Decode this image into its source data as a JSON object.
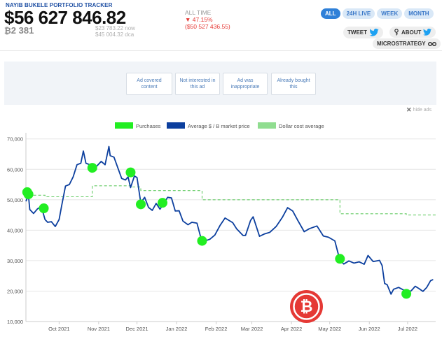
{
  "header": {
    "brand": "NAYIB BUKELE PORTFOLIO TRACKER",
    "portfolio_value": "$56 627 846.82",
    "btc_count": "2 381",
    "price_now": "$23 783.22 now",
    "price_dca": "$45 004.32 dca",
    "alltime_label": "ALL TIME",
    "alltime_pct": "▼ 47.15%",
    "alltime_delta": "($50 527 436.55)"
  },
  "tabs": [
    {
      "label": "ALL",
      "active": true
    },
    {
      "label": "24H LIVE",
      "active": false
    },
    {
      "label": "WEEK",
      "active": false
    },
    {
      "label": "MONTH",
      "active": false
    }
  ],
  "actions": {
    "tweet": "TWEET",
    "about": "ABOUT",
    "microstrategy": "MICROSTRATEGY"
  },
  "ad": {
    "options": [
      "Ad covered content",
      "Not interested in this ad",
      "Ad was inappropriate",
      "Already bought this"
    ],
    "hide_ads": "hide ads"
  },
  "colors": {
    "accent": "#2f80d8",
    "negative": "#e53935",
    "purchase": "#22ee22",
    "price_line": "#0c3f9e",
    "dca_line": "#66cc66"
  },
  "chart_data": {
    "type": "line",
    "legend": [
      "Purchases",
      "Average $ / B market price",
      "Dollar cost average"
    ],
    "x_ticks": [
      "Oct 2021",
      "Nov 2021",
      "Dec 2021",
      "Jan 2022",
      "Feb 2022",
      "Mar 2022",
      "Apr 2022",
      "May 2022",
      "Jun 2022",
      "Jul 2022"
    ],
    "y_ticks": [
      "10,000",
      "20,000",
      "30,000",
      "40,000",
      "50,000",
      "60,000",
      "70,000"
    ],
    "ylim": [
      10000,
      72000
    ],
    "xlim": [
      "2021-09-05",
      "2022-07-23"
    ],
    "series": [
      {
        "name": "Average $ / B market price",
        "points": [
          [
            "2021-09-05",
            49500
          ],
          [
            "2021-09-07",
            51500
          ],
          [
            "2021-09-08",
            46800
          ],
          [
            "2021-09-11",
            45500
          ],
          [
            "2021-09-14",
            47000
          ],
          [
            "2021-09-17",
            47800
          ],
          [
            "2021-09-20",
            43500
          ],
          [
            "2021-09-22",
            42600
          ],
          [
            "2021-09-25",
            42800
          ],
          [
            "2021-09-28",
            41200
          ],
          [
            "2021-10-01",
            43500
          ],
          [
            "2021-10-03",
            48000
          ],
          [
            "2021-10-06",
            54500
          ],
          [
            "2021-10-09",
            55000
          ],
          [
            "2021-10-12",
            57500
          ],
          [
            "2021-10-15",
            61500
          ],
          [
            "2021-10-18",
            62000
          ],
          [
            "2021-10-20",
            66000
          ],
          [
            "2021-10-22",
            62000
          ],
          [
            "2021-10-25",
            61500
          ],
          [
            "2021-10-28",
            60000
          ],
          [
            "2021-10-31",
            61300
          ],
          [
            "2021-11-03",
            62600
          ],
          [
            "2021-11-06",
            61500
          ],
          [
            "2021-11-09",
            67500
          ],
          [
            "2021-11-10",
            64500
          ],
          [
            "2021-11-13",
            64000
          ],
          [
            "2021-11-16",
            60500
          ],
          [
            "2021-11-19",
            57000
          ],
          [
            "2021-11-22",
            56500
          ],
          [
            "2021-11-24",
            57500
          ],
          [
            "2021-11-26",
            54000
          ],
          [
            "2021-11-29",
            57800
          ],
          [
            "2021-12-01",
            57300
          ],
          [
            "2021-12-04",
            49000
          ],
          [
            "2021-12-07",
            50800
          ],
          [
            "2021-12-10",
            47500
          ],
          [
            "2021-12-13",
            46500
          ],
          [
            "2021-12-16",
            48800
          ],
          [
            "2021-12-19",
            46900
          ],
          [
            "2021-12-22",
            48800
          ],
          [
            "2021-12-25",
            50800
          ],
          [
            "2021-12-28",
            50600
          ],
          [
            "2021-12-31",
            46300
          ],
          [
            "2022-01-03",
            46400
          ],
          [
            "2022-01-06",
            43000
          ],
          [
            "2022-01-10",
            41800
          ],
          [
            "2022-01-13",
            42600
          ],
          [
            "2022-01-17",
            42300
          ],
          [
            "2022-01-21",
            36000
          ],
          [
            "2022-01-24",
            36600
          ],
          [
            "2022-01-27",
            37000
          ],
          [
            "2022-01-31",
            38400
          ],
          [
            "2022-02-04",
            41500
          ],
          [
            "2022-02-08",
            44000
          ],
          [
            "2022-02-10",
            43500
          ],
          [
            "2022-02-14",
            42500
          ],
          [
            "2022-02-17",
            40500
          ],
          [
            "2022-02-22",
            38300
          ],
          [
            "2022-02-24",
            38300
          ],
          [
            "2022-02-28",
            43200
          ],
          [
            "2022-03-02",
            44400
          ],
          [
            "2022-03-07",
            38000
          ],
          [
            "2022-03-11",
            38800
          ],
          [
            "2022-03-15",
            39300
          ],
          [
            "2022-03-20",
            41200
          ],
          [
            "2022-03-25",
            44300
          ],
          [
            "2022-03-29",
            47400
          ],
          [
            "2022-04-02",
            46300
          ],
          [
            "2022-04-06",
            43200
          ],
          [
            "2022-04-11",
            39500
          ],
          [
            "2022-04-15",
            40500
          ],
          [
            "2022-04-21",
            41400
          ],
          [
            "2022-04-26",
            38100
          ],
          [
            "2022-04-30",
            37700
          ],
          [
            "2022-05-05",
            36500
          ],
          [
            "2022-05-09",
            30100
          ],
          [
            "2022-05-12",
            28900
          ],
          [
            "2022-05-16",
            29900
          ],
          [
            "2022-05-20",
            29200
          ],
          [
            "2022-05-24",
            29600
          ],
          [
            "2022-05-28",
            28800
          ],
          [
            "2022-05-31",
            31700
          ],
          [
            "2022-06-04",
            29700
          ],
          [
            "2022-06-09",
            30100
          ],
          [
            "2022-06-11",
            28400
          ],
          [
            "2022-06-13",
            22500
          ],
          [
            "2022-06-15",
            22100
          ],
          [
            "2022-06-18",
            19000
          ],
          [
            "2022-06-20",
            20600
          ],
          [
            "2022-06-24",
            21200
          ],
          [
            "2022-06-28",
            20300
          ],
          [
            "2022-07-01",
            19300
          ],
          [
            "2022-07-04",
            20200
          ],
          [
            "2022-07-07",
            21600
          ],
          [
            "2022-07-10",
            20800
          ],
          [
            "2022-07-13",
            19900
          ],
          [
            "2022-07-16",
            21200
          ],
          [
            "2022-07-19",
            23400
          ],
          [
            "2022-07-21",
            23800
          ]
        ]
      },
      {
        "name": "Dollar cost average",
        "points": [
          [
            "2021-09-07",
            51500
          ],
          [
            "2021-09-20",
            51500
          ],
          [
            "2021-09-20",
            51000
          ],
          [
            "2021-10-27",
            51000
          ],
          [
            "2021-10-27",
            54600
          ],
          [
            "2021-11-26",
            54600
          ],
          [
            "2021-11-26",
            54200
          ],
          [
            "2021-12-04",
            54200
          ],
          [
            "2021-12-04",
            53000
          ],
          [
            "2021-12-21",
            53000
          ],
          [
            "2021-12-21",
            53000
          ],
          [
            "2022-01-21",
            53000
          ],
          [
            "2022-01-21",
            50000
          ],
          [
            "2022-05-09",
            50000
          ],
          [
            "2022-05-09",
            45400
          ],
          [
            "2022-06-30",
            45400
          ],
          [
            "2022-06-30",
            45000
          ],
          [
            "2022-07-23",
            45000
          ]
        ]
      }
    ],
    "purchases": [
      [
        "2021-09-06",
        52500
      ],
      [
        "2021-09-07",
        51800
      ],
      [
        "2021-09-19",
        47200
      ],
      [
        "2021-10-27",
        60500
      ],
      [
        "2021-11-26",
        59000
      ],
      [
        "2021-12-04",
        48500
      ],
      [
        "2021-12-21",
        49000
      ],
      [
        "2022-01-21",
        36500
      ],
      [
        "2022-05-09",
        30600
      ],
      [
        "2022-06-30",
        19100
      ]
    ]
  }
}
